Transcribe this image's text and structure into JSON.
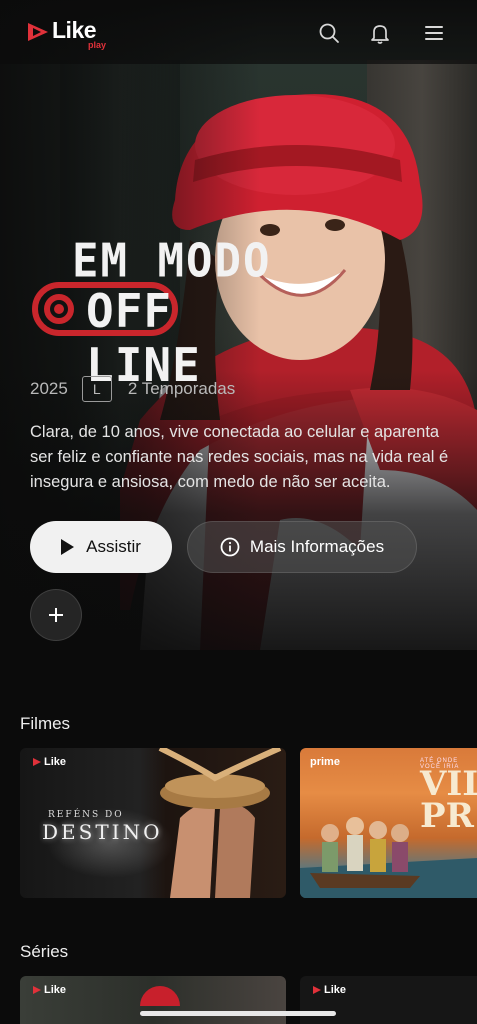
{
  "colors": {
    "brand_red": "#e0313a",
    "background": "#0b0b0b",
    "button_light": "#f1f1f1"
  },
  "header": {
    "logo_text": "Like",
    "logo_sub": "play",
    "icons": [
      "search-icon",
      "bell-icon",
      "menu-icon"
    ]
  },
  "hero": {
    "title_line1": "EM MODO",
    "title_line2": "OFF LINE",
    "year": "2025",
    "rating": "L",
    "seasons": "2 Temporadas",
    "synopsis": "Clara, de 10 anos, vive conectada ao celular e aparenta ser feliz e confiante nas redes sociais, mas na vida real é insegura e ansiosa, com medo de não ser aceita.",
    "watch_label": "Assistir",
    "info_label": "Mais Informações",
    "add_label": "+"
  },
  "rows": [
    {
      "title": "Filmes",
      "items": [
        {
          "badge": "Like",
          "text_small": "REFÉNS DO",
          "text_big": "DESTINO"
        },
        {
          "brand": "prime",
          "title": "VILA PR",
          "tiny": "ATÉ ONDE VOCÊ IRIA"
        }
      ]
    },
    {
      "title": "Séries",
      "items": [
        {
          "badge": "Like"
        },
        {
          "badge": "Like"
        }
      ]
    }
  ]
}
